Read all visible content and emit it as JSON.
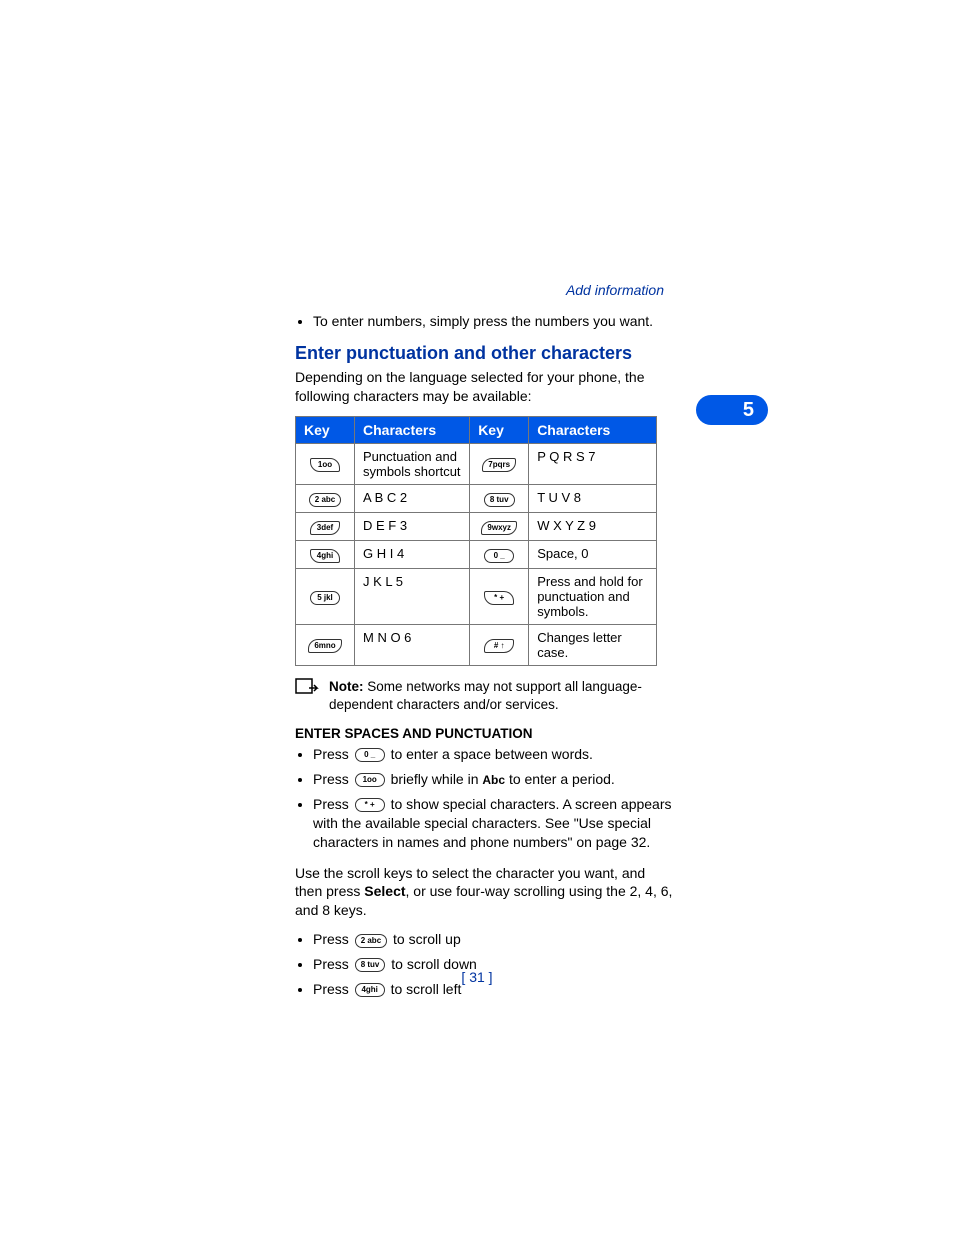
{
  "header": {
    "section_link": "Add information"
  },
  "chapter": {
    "number": "5"
  },
  "intro_bullet": "To enter numbers, simply press the numbers you want.",
  "section": {
    "heading": "Enter punctuation and other characters",
    "intro": "Depending on the language selected for your phone, the following characters may be available:"
  },
  "table": {
    "headers": {
      "key": "Key",
      "chars": "Characters"
    },
    "rows_left": [
      {
        "key": "1oo",
        "chars": "Punctuation and symbols shortcut"
      },
      {
        "key": "2 abc",
        "chars": "A B C 2"
      },
      {
        "key": "3def",
        "chars": "D E F 3"
      },
      {
        "key": "4ghi",
        "chars": "G H I 4"
      },
      {
        "key": "5 jkl",
        "chars": "J K L 5"
      },
      {
        "key": "6mno",
        "chars": "M N O 6"
      }
    ],
    "rows_right": [
      {
        "key": "7pqrs",
        "chars": "P Q R S 7"
      },
      {
        "key": "8 tuv",
        "chars": "T U V 8"
      },
      {
        "key": "9wxyz",
        "chars": "W X Y Z 9"
      },
      {
        "key": "0 _",
        "chars": "Space, 0"
      },
      {
        "key": "* +",
        "chars": "Press and hold for punctuation and symbols."
      },
      {
        "key": "# ↑",
        "chars": "Changes letter case."
      }
    ]
  },
  "note": {
    "label": "Note:",
    "text": " Some networks may not support all language-dependent characters and/or services."
  },
  "spaces": {
    "heading": "ENTER SPACES AND PUNCTUATION",
    "b1_pre": "Press ",
    "b1_key": "0 _",
    "b1_post": " to enter a space between words.",
    "b2_pre": "Press ",
    "b2_key": "1oo",
    "b2_mid": " briefly while in ",
    "b2_mode": "Abc",
    "b2_post": " to enter a period.",
    "b3_pre": "Press ",
    "b3_key": "* +",
    "b3_post": " to show special characters. A screen appears with the available special characters. See \"Use special characters in names and phone numbers\" on page 32."
  },
  "scroll_intro_pre": "Use the scroll keys to select the character you want, and then press ",
  "scroll_intro_bold": "Select",
  "scroll_intro_post": ", or use four-way scrolling using the 2, 4, 6, and 8 keys.",
  "scroll": {
    "b1_pre": "Press ",
    "b1_key": "2 abc",
    "b1_post": " to scroll up",
    "b2_pre": "Press ",
    "b2_key": "8 tuv",
    "b2_post": " to scroll down",
    "b3_pre": "Press ",
    "b3_key": "4ghi",
    "b3_post": " to scroll left"
  },
  "page_number": "[ 31 ]"
}
